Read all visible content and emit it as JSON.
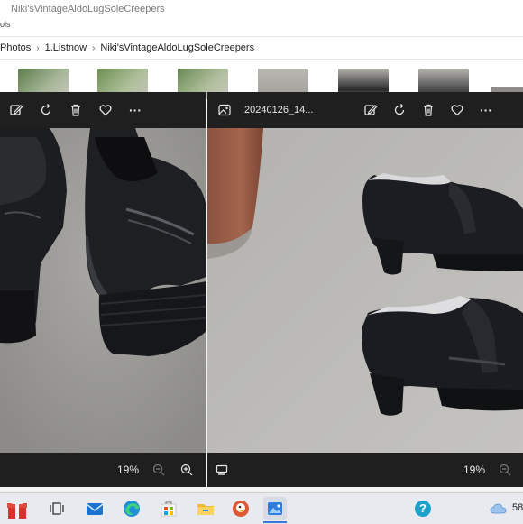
{
  "explorer": {
    "title": "Niki'sVintageAldoLugSoleCreepers",
    "ribbon_tab": "ols",
    "breadcrumb": [
      "Photos",
      "1.Listnow",
      "Niki'sVintageAldoLugSoleCreepers"
    ]
  },
  "viewer_left": {
    "toolbar_icons": [
      "edit-icon",
      "rotate-icon",
      "delete-icon",
      "favorite-icon",
      "more-icon"
    ],
    "more_label": "···",
    "zoom": "19%"
  },
  "viewer_right": {
    "file_name": "20240126_14...",
    "toolbar_icons": [
      "edit-icon",
      "rotate-icon",
      "delete-icon",
      "favorite-icon",
      "more-icon"
    ],
    "more_label": "···",
    "zoom": "19%"
  },
  "taskbar": {
    "apps": [
      "gift-icon",
      "task-view-icon",
      "mail-icon",
      "edge-icon",
      "store-icon",
      "file-explorer-icon",
      "duckduckgo-icon",
      "photos-icon"
    ],
    "help_label": "?",
    "weather_temp": "58"
  },
  "colors": {
    "viewer_bg": "#1f1f1f",
    "pavement": "#9b9a96",
    "shoe": "#1c1d20",
    "taskbar": "#e8eaf0"
  }
}
